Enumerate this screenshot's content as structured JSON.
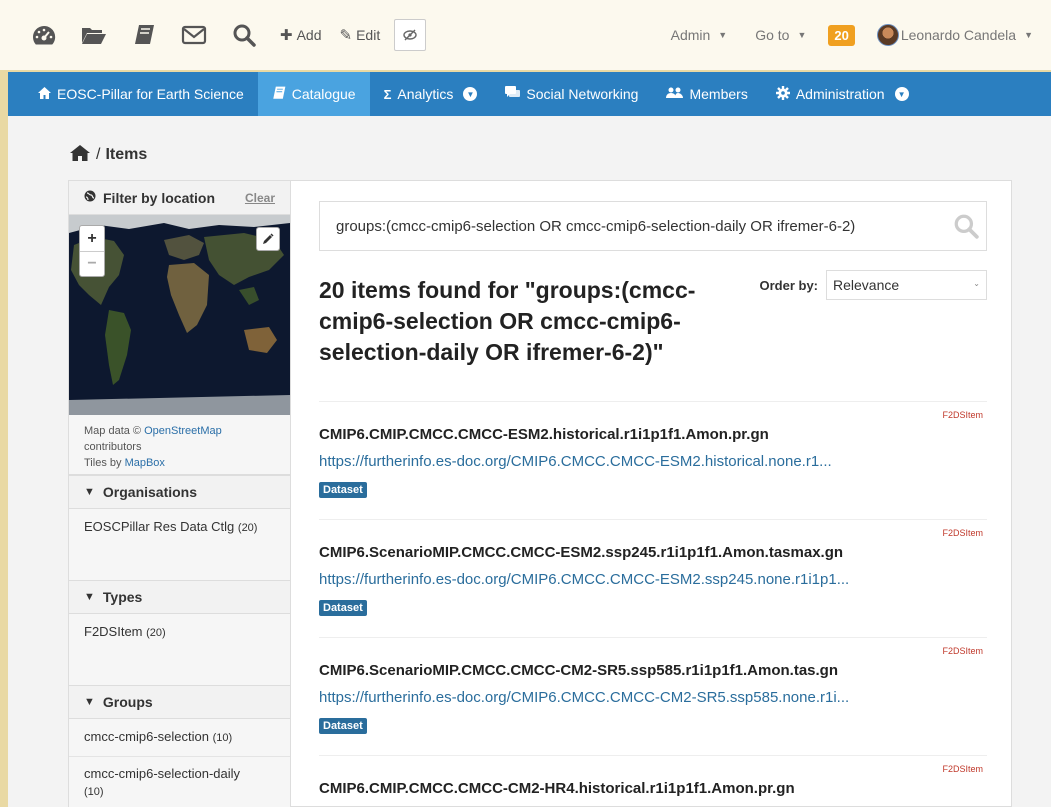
{
  "topbar": {
    "icons": [
      "dashboard-icon",
      "folder-icon",
      "book-icon",
      "envelope-icon",
      "search-icon"
    ],
    "add_label": "Add",
    "edit_label": "Edit",
    "admin_label": "Admin",
    "goto_label": "Go to",
    "notification_count": "20",
    "user_name": "Leonardo Candela"
  },
  "nav": {
    "items": [
      {
        "label": "EOSC-Pillar for Earth Science",
        "icon": "home-icon"
      },
      {
        "label": "Catalogue",
        "icon": "book-icon",
        "active": true
      },
      {
        "label": "Analytics",
        "icon": "sigma-icon",
        "has_dropdown": true
      },
      {
        "label": "Social Networking",
        "icon": "chat-icon"
      },
      {
        "label": "Members",
        "icon": "users-icon"
      },
      {
        "label": "Administration",
        "icon": "gear-icon",
        "has_dropdown": true
      }
    ]
  },
  "breadcrumb": {
    "separator": "/",
    "current": "Items"
  },
  "sidebar": {
    "location": {
      "title": "Filter by location",
      "clear_label": "Clear",
      "zoom_in": "+",
      "zoom_out": "−",
      "attribution_prefix": "Map data ©",
      "attribution_osm": "OpenStreetMap",
      "attribution_contributors": "contributors",
      "attribution_tiles": "Tiles by",
      "attribution_mapbox": "MapBox"
    },
    "organisations": {
      "title": "Organisations",
      "items": [
        {
          "label": "EOSCPillar Res Data Ctlg",
          "count": "(20)"
        }
      ]
    },
    "types": {
      "title": "Types",
      "items": [
        {
          "label": "F2DSItem",
          "count": "(20)"
        }
      ]
    },
    "groups": {
      "title": "Groups",
      "items": [
        {
          "label": "cmcc-cmip6-selection",
          "count": "(10)"
        },
        {
          "label": "cmcc-cmip6-selection-daily",
          "count": "(10)"
        }
      ]
    }
  },
  "search": {
    "query": "groups:(cmcc-cmip6-selection OR cmcc-cmip6-selection-daily OR ifremer-6-2)"
  },
  "results": {
    "title": "20 items found for \"groups:(cmcc-cmip6-selection OR cmcc-cmip6-selection-daily OR ifremer-6-2)\"",
    "order_label": "Order by:",
    "order_value": "Relevance",
    "items": [
      {
        "type": "F2DSItem",
        "name": "CMIP6.CMIP.CMCC.CMCC-ESM2.historical.r1i1p1f1.Amon.pr.gn",
        "url": "https://furtherinfo.es-doc.org/CMIP6.CMCC.CMCC-ESM2.historical.none.r1...",
        "badge": "Dataset"
      },
      {
        "type": "F2DSItem",
        "name": "CMIP6.ScenarioMIP.CMCC.CMCC-ESM2.ssp245.r1i1p1f1.Amon.tasmax.gn",
        "url": "https://furtherinfo.es-doc.org/CMIP6.CMCC.CMCC-ESM2.ssp245.none.r1i1p1...",
        "badge": "Dataset"
      },
      {
        "type": "F2DSItem",
        "name": "CMIP6.ScenarioMIP.CMCC.CMCC-CM2-SR5.ssp585.r1i1p1f1.Amon.tas.gn",
        "url": "https://furtherinfo.es-doc.org/CMIP6.CMCC.CMCC-CM2-SR5.ssp585.none.r1i...",
        "badge": "Dataset"
      },
      {
        "type": "F2DSItem",
        "name": "CMIP6.CMIP.CMCC.CMCC-CM2-HR4.historical.r1i1p1f1.Amon.pr.gn",
        "url": "",
        "badge": ""
      }
    ]
  },
  "colors": {
    "nav_bg": "#2b7fc0",
    "nav_active": "#4aa3e0",
    "link": "#2a6d9c",
    "badge_orange": "#f0a020",
    "type_tag": "#c0392b"
  }
}
